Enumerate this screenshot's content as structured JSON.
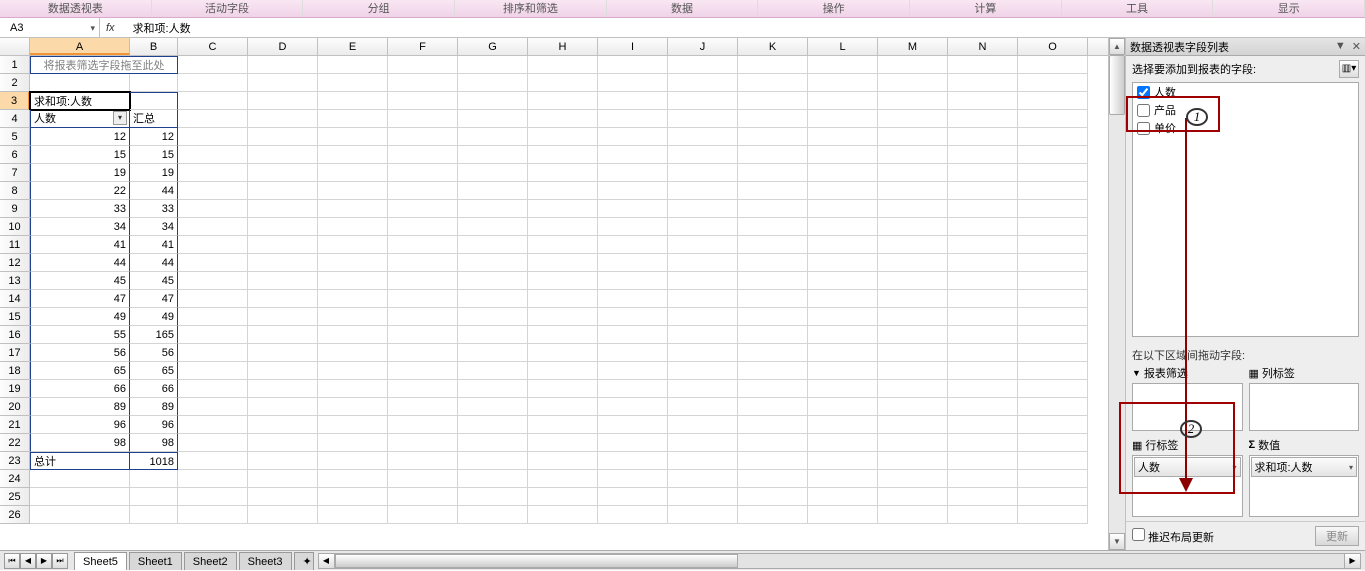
{
  "ribbon": {
    "tabs": [
      "数据透视表",
      "活动字段",
      "分组",
      "排序和筛选",
      "数据",
      "操作",
      "计算",
      "工具",
      "显示"
    ]
  },
  "nameBox": "A3",
  "fxLabel": "fx",
  "formula": "求和项:人数",
  "columns": [
    "A",
    "B",
    "C",
    "D",
    "E",
    "F",
    "G",
    "H",
    "I",
    "J",
    "K",
    "L",
    "M",
    "N",
    "O"
  ],
  "selectedCol": "A",
  "selectedRow": 3,
  "mergedHint": "将报表筛选字段拖至此处",
  "pivot": {
    "header": "求和项:人数",
    "rowLabel": "人数",
    "colLabel": "汇总",
    "totalLabel": "总计",
    "rows": [
      {
        "a": 12,
        "b": 12
      },
      {
        "a": 15,
        "b": 15
      },
      {
        "a": 19,
        "b": 19
      },
      {
        "a": 22,
        "b": 44
      },
      {
        "a": 33,
        "b": 33
      },
      {
        "a": 34,
        "b": 34
      },
      {
        "a": 41,
        "b": 41
      },
      {
        "a": 44,
        "b": 44
      },
      {
        "a": 45,
        "b": 45
      },
      {
        "a": 47,
        "b": 47
      },
      {
        "a": 49,
        "b": 49
      },
      {
        "a": 55,
        "b": 165
      },
      {
        "a": 56,
        "b": 56
      },
      {
        "a": 65,
        "b": 65
      },
      {
        "a": 66,
        "b": 66
      },
      {
        "a": 89,
        "b": 89
      },
      {
        "a": 96,
        "b": 96
      },
      {
        "a": 98,
        "b": 98
      }
    ],
    "grandTotal": 1018
  },
  "fieldPane": {
    "title": "数据透视表字段列表",
    "chooseLabel": "选择要添加到报表的字段:",
    "fields": [
      {
        "name": "人数",
        "checked": true
      },
      {
        "name": "产品",
        "checked": false
      },
      {
        "name": "单价",
        "checked": false
      }
    ],
    "dragLabel": "在以下区域间拖动字段:",
    "areas": {
      "filter": {
        "title": "报表筛选",
        "items": []
      },
      "columns": {
        "title": "列标签",
        "items": []
      },
      "rows": {
        "title": "行标签",
        "items": [
          "人数"
        ]
      },
      "values": {
        "title": "数值",
        "items": [
          "求和项:人数"
        ]
      }
    },
    "deferLabel": "推迟布局更新",
    "updateBtn": "更新"
  },
  "sheets": {
    "tabs": [
      "Sheet5",
      "Sheet1",
      "Sheet2",
      "Sheet3"
    ],
    "active": "Sheet5"
  },
  "annotations": {
    "circle1": "1",
    "circle2": "2"
  }
}
